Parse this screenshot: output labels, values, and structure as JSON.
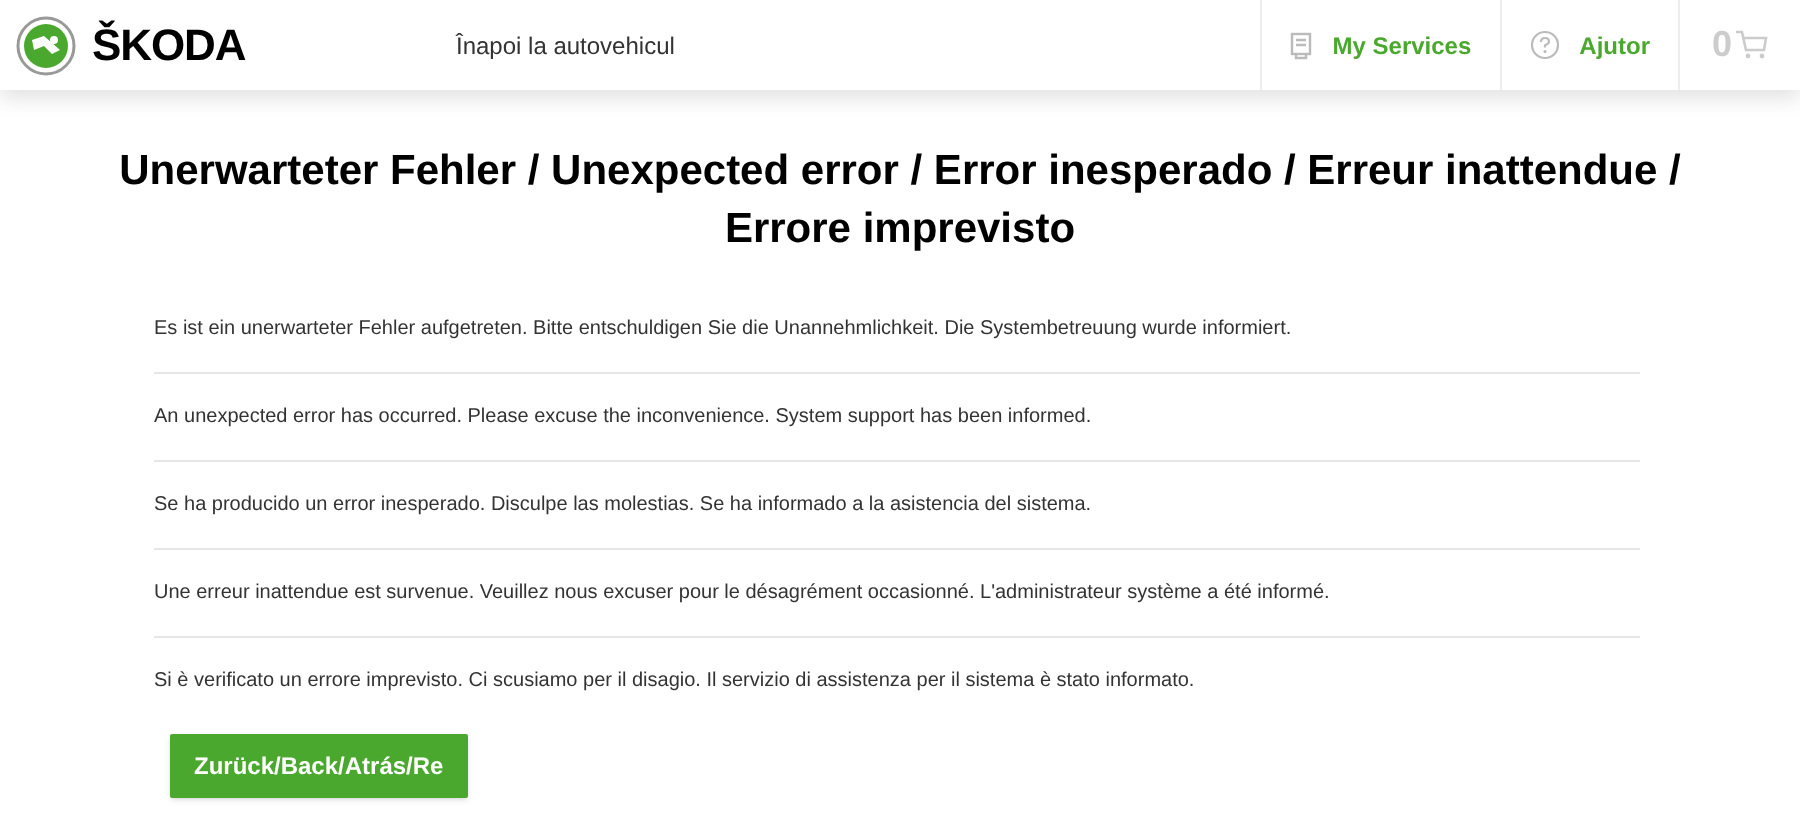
{
  "header": {
    "brand": "ŠKODA",
    "back_link": "Înapoi la autovehicul",
    "nav": [
      {
        "label": "My Services",
        "kind": "services"
      },
      {
        "label": "Ajutor",
        "kind": "help"
      }
    ],
    "cart_count": "0"
  },
  "title": "Unerwarteter Fehler / Unexpected error / Error inesperado / Erreur inattendue / Errore imprevisto",
  "messages": [
    "Es ist ein unerwarteter Fehler aufgetreten. Bitte entschuldigen Sie die Unannehmlichkeit. Die Systembetreuung wurde informiert.",
    "An unexpected error has occurred. Please excuse the inconvenience. System support has been informed.",
    "Se ha producido un error inesperado. Disculpe las molestias. Se ha informado a la asistencia del sistema.",
    "Une erreur inattendue est survenue. Veuillez nous excuser pour le désagrément occasionné. L'administrateur système a été informé.",
    "Si è verificato un errore imprevisto. Ci scusiamo per il disagio. Il servizio di assistenza per il sistema è stato informato."
  ],
  "back_button": "Zurück/Back/Atrás/Re"
}
